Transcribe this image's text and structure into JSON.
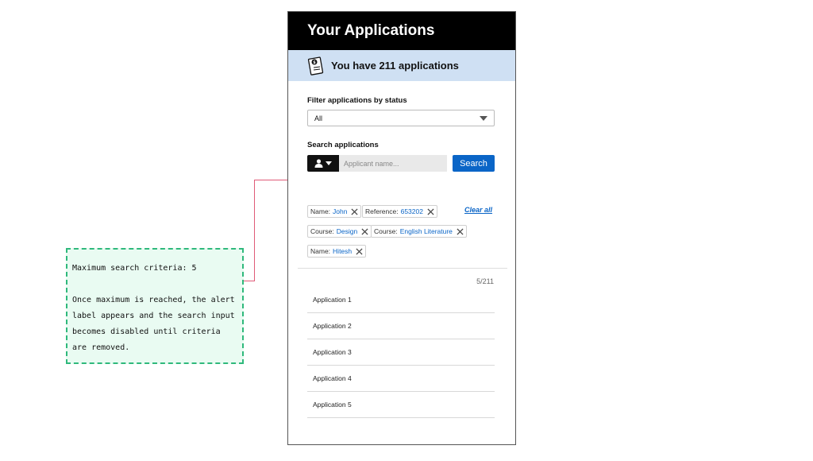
{
  "header": {
    "title": "Your Applications"
  },
  "banner": {
    "text": "You have 211 applications"
  },
  "filter": {
    "label": "Filter applications by status",
    "selected": "All"
  },
  "search": {
    "label": "Search applications",
    "placeholder": "Applicant name...",
    "button_label": "Search"
  },
  "chips": [
    {
      "key": "Name:",
      "value": "John"
    },
    {
      "key": "Reference:",
      "value": "653202"
    },
    {
      "key": "Course:",
      "value": "Design"
    },
    {
      "key": "Course:",
      "value": "English Literature"
    },
    {
      "key": "Name:",
      "value": "Hitesh"
    }
  ],
  "clear_all_label": "Clear all",
  "results": {
    "count": "5/211",
    "items": [
      "Application 1",
      "Application 2",
      "Application 3",
      "Application 4",
      "Application 5"
    ]
  },
  "annotation": {
    "line1": "Maximum search criteria: 5",
    "line2": "Once maximum is reached, the alert label appears and the search input becomes disabled until criteria are removed."
  },
  "colors": {
    "accent": "#0a65c7",
    "header_bg": "#000000",
    "banner_bg": "#cfe0f3",
    "note_border": "#2fb97c",
    "connector": "#e05a78"
  },
  "icons": {
    "banner": "document-icon",
    "user_type": "person-icon",
    "chip_remove": "close-icon",
    "select": "chevron-down-icon"
  }
}
